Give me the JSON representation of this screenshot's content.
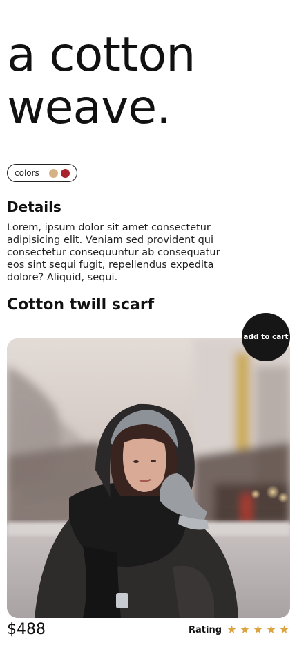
{
  "hero": {
    "title_line1": "a cotton",
    "title_line2": "weave."
  },
  "colors": {
    "label": "colors",
    "swatches": [
      "#d4b284",
      "#a8232b"
    ]
  },
  "details": {
    "heading": "Details",
    "body": "Lorem, ipsum dolor sit amet consectetur adipisicing elit. Veniam sed provident qui consectetur consequuntur ab consequatur eos sint sequi fugit, repellendus expedita dolore? Aliquid, sequi."
  },
  "product": {
    "name": "Cotton twill scarf",
    "price": "$488",
    "add_to_cart_label": "add to cart",
    "image_icon": "product-photo"
  },
  "rating": {
    "label": "Rating",
    "value": 5,
    "max": 5,
    "star_color": "#d9a441"
  }
}
